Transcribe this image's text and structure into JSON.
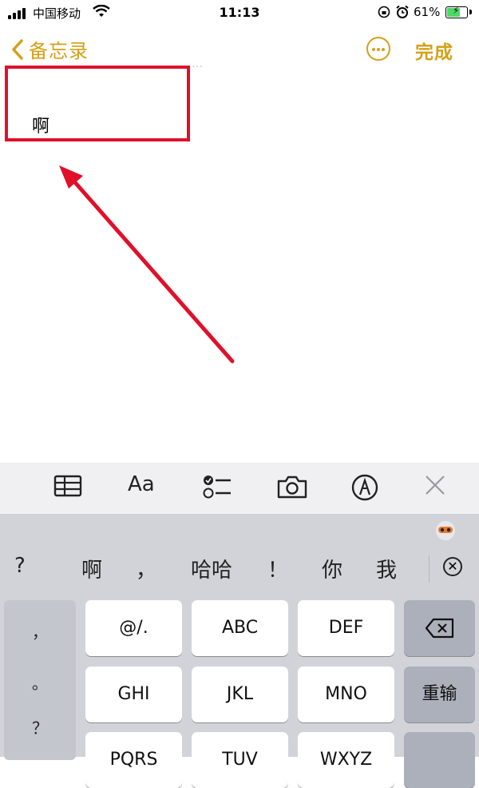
{
  "status_bar": {
    "carrier": "中国移动",
    "time": "11:13",
    "battery_percent": "61%"
  },
  "nav": {
    "back_label": "备忘录",
    "done_label": "完成"
  },
  "note": {
    "faint_date": "...",
    "body_text": "啊"
  },
  "toolbar": {
    "icons": [
      "table-icon",
      "text-format-icon",
      "checklist-icon",
      "camera-icon",
      "markup-icon",
      "close-icon"
    ],
    "format_label": "Aa"
  },
  "candidates": [
    "?",
    "啊",
    "，",
    "哈哈",
    "！",
    "你",
    "我"
  ],
  "punctuation": [
    "，",
    "。",
    "？"
  ],
  "keys": {
    "row1": [
      "@/.",
      "ABC",
      "DEF"
    ],
    "row2": [
      "GHI",
      "JKL",
      "MNO"
    ],
    "row3": [
      "PQRS",
      "TUV",
      "WXYZ"
    ],
    "retype": "重输"
  },
  "colors": {
    "accent": "#d4a017",
    "highlight": "#e0102a",
    "keyboard_bg": "#d1d3d9"
  }
}
